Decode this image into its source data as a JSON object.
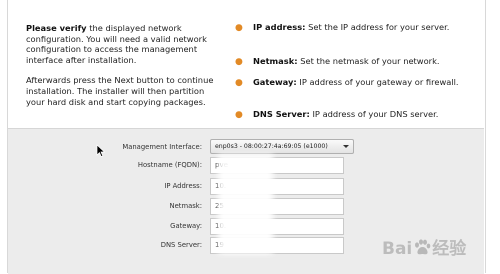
{
  "intro": {
    "bold_lead": "Please verify",
    "para1_rest": " the displayed network configuration. You will need a valid network configuration to access the management interface after installation.",
    "para2": "Afterwards press the Next button to continue installation. The installer will then partition your hard disk and start copying packages."
  },
  "bullets": [
    {
      "term": "IP address:",
      "desc": " Set the IP address for your server."
    },
    {
      "term": "Netmask:",
      "desc": " Set the netmask of your network."
    },
    {
      "term": "Gateway:",
      "desc": " IP address of your gateway or firewall."
    },
    {
      "term": "DNS Server:",
      "desc": " IP address of your DNS server."
    }
  ],
  "form": {
    "management_interface": {
      "label": "Management Interface:",
      "value": "enp0s3 - 08:00:27:4a:69:05 (e1000)"
    },
    "hostname": {
      "label": "Hostname (FQDN):",
      "value": "pve"
    },
    "ip_address": {
      "label": "IP Address:",
      "value": "10."
    },
    "netmask": {
      "label": "Netmask:",
      "value": "25"
    },
    "gateway": {
      "label": "Gateway:",
      "value": "10."
    },
    "dns_server": {
      "label": "DNS Server:",
      "value": "19"
    }
  },
  "watermark": {
    "text_left": "Bai",
    "text_right": "经验"
  },
  "colors": {
    "bullet": "#e28a26",
    "form_bg": "#ececec"
  }
}
